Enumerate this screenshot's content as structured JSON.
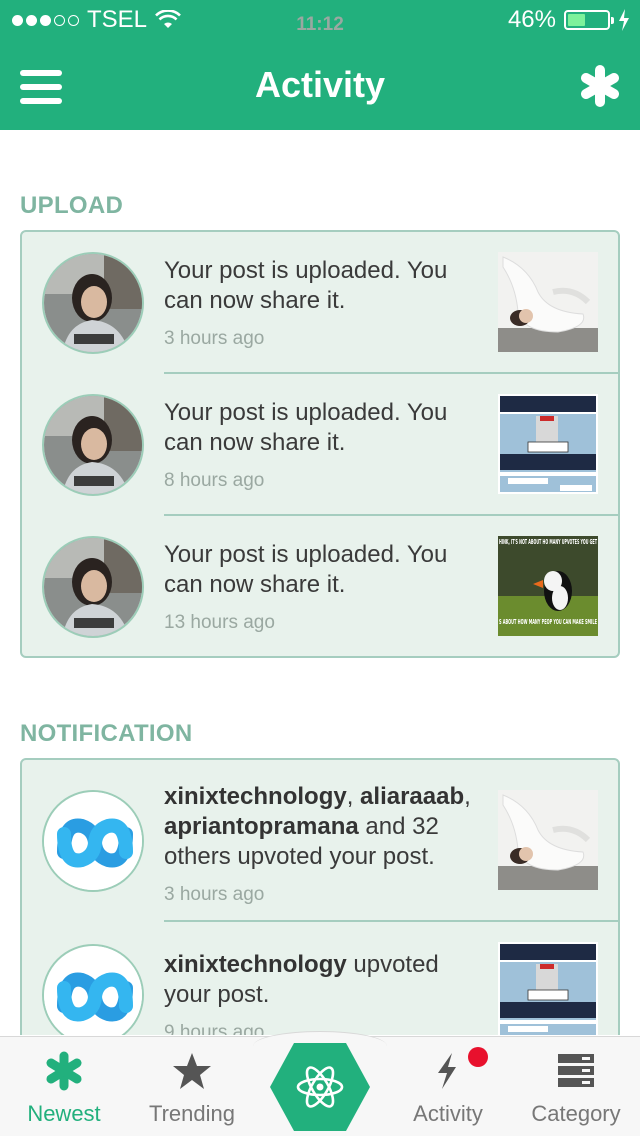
{
  "status_bar": {
    "carrier": "TSEL",
    "time": "11:12",
    "battery": "46%",
    "battery_level": 0.46
  },
  "nav": {
    "title": "Activity",
    "menu_icon": "hamburger-icon",
    "right_icon": "asterisk-icon"
  },
  "upload": {
    "title": "UPLOAD",
    "items": [
      {
        "text": "Your post is uploaded. You can now share it.",
        "time": "3 hours ago",
        "thumb": "woman-photo"
      },
      {
        "text": "Your post is uploaded. You can now share it.",
        "time": "8 hours ago",
        "thumb": "comic-strip"
      },
      {
        "text": "Your post is uploaded. You can now share it.",
        "time": "13 hours ago",
        "thumb": "puffin-meme"
      }
    ]
  },
  "notification": {
    "title": "NOTIFICATION",
    "items": [
      {
        "user1": "xinixtechnology",
        "sep1": ", ",
        "user2": "aliaraaab",
        "sep2": ",",
        "user3": "apriantopramana",
        "rest": " and 32 others upvoted your post.",
        "time": "3 hours ago",
        "thumb": "woman-photo"
      },
      {
        "user1": "xinixtechnology",
        "rest": " upvoted your post.",
        "time": "9 hours ago",
        "thumb": "comic-strip"
      }
    ]
  },
  "meme_text": {
    "top": "HINK, IT'S NOT ABOUT HO MANY UPVOTES YOU GET",
    "bottom": "S ABOUT HOW MANY PEOP YOU CAN MAKE SMILE"
  },
  "tabs": [
    {
      "label": "Newest",
      "icon": "asterisk-icon",
      "active": true
    },
    {
      "label": "Trending",
      "icon": "star-icon",
      "active": false
    },
    {
      "label": "",
      "icon": "atom-icon",
      "active": false
    },
    {
      "label": "Activity",
      "icon": "lightning-icon",
      "active": false
    },
    {
      "label": "Category",
      "icon": "server-stack-icon",
      "active": false
    }
  ],
  "colors": {
    "brand": "#22b07d",
    "card_bg": "#e8f2ec",
    "card_border": "#a5cdbf",
    "section_title": "#7fb5a1",
    "badge": "#e8112d"
  }
}
